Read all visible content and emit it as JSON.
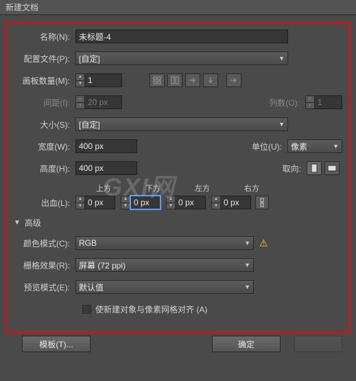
{
  "title": "新建文档",
  "labels": {
    "name": "名称(N):",
    "profile": "配置文件(P):",
    "artboards": "画板数量(M):",
    "spacing": "间距(I):",
    "columns": "列数(O):",
    "size": "大小(S):",
    "width": "宽度(W):",
    "height": "高度(H):",
    "units": "单位(U):",
    "orientation": "取向:",
    "bleed": "出血(L):",
    "top": "上方",
    "bottom": "下方",
    "left": "左方",
    "right": "右方",
    "advanced": "高级",
    "colorMode": "颜色模式(C):",
    "raster": "栅格效果(R):",
    "preview": "预览模式(E):",
    "align": "使新建对象与像素网格对齐 (A)"
  },
  "values": {
    "name": "未标题-4",
    "profile": "[自定]",
    "artboards": "1",
    "spacing": "20 px",
    "columns": "1",
    "size": "[自定]",
    "width": "400 px",
    "height": "400 px",
    "units": "像素",
    "bleedTop": "0 px",
    "bleedBottom": "0 px",
    "bleedLeft": "0 px",
    "bleedRight": "0 px",
    "colorMode": "RGB",
    "raster": "屏幕 (72 ppi)",
    "preview": "默认值"
  },
  "buttons": {
    "template": "模板(T)...",
    "ok": "确定"
  }
}
